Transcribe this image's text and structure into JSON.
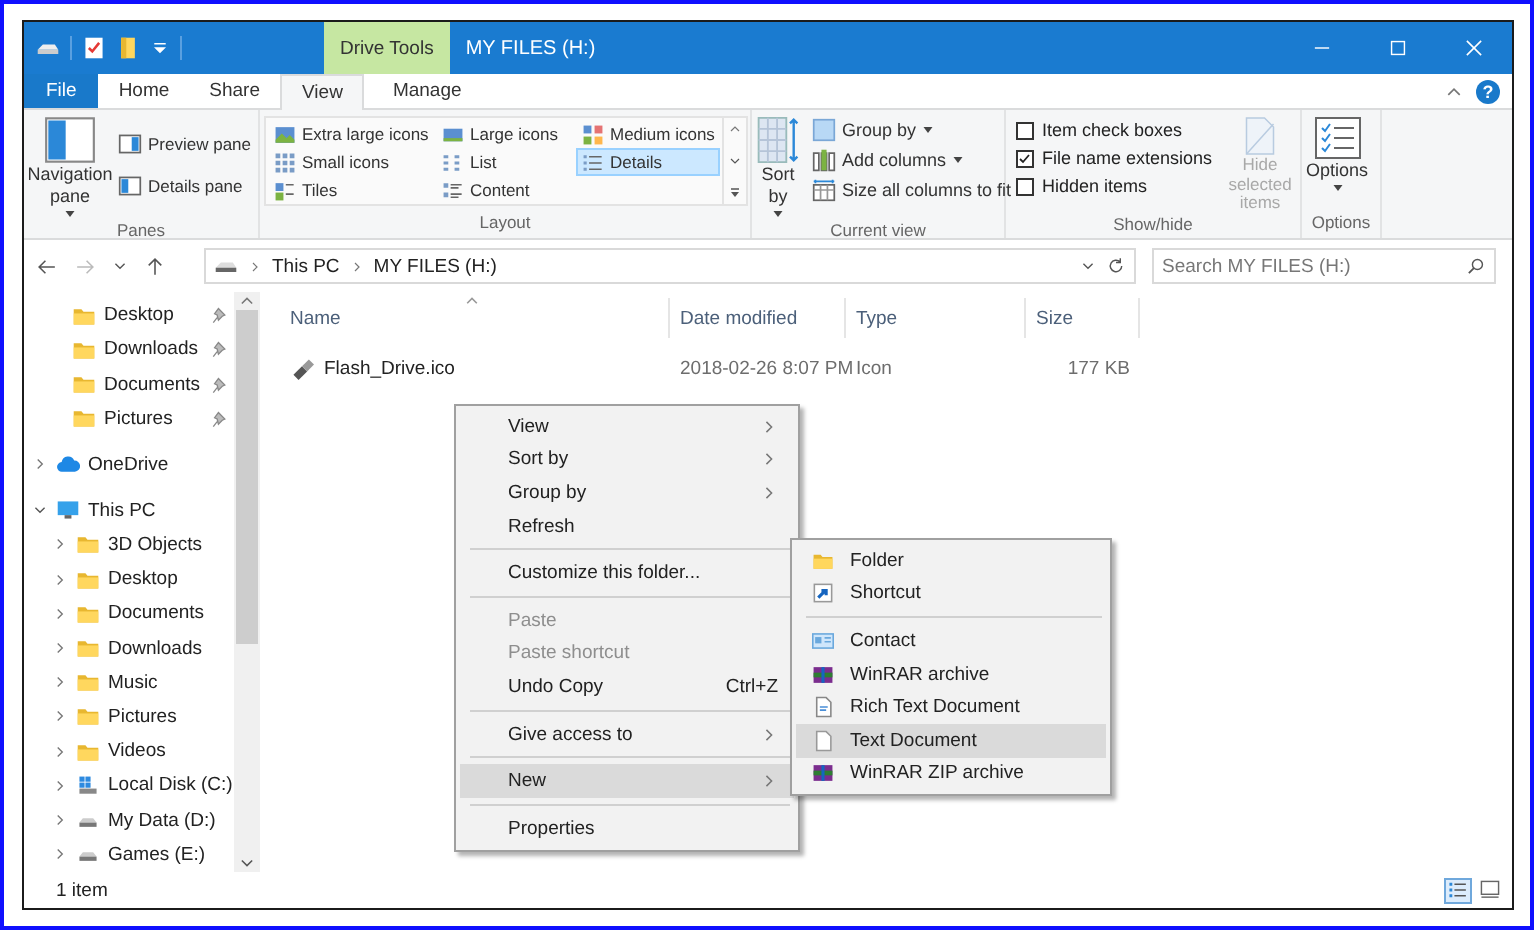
{
  "window": {
    "title": "MY FILES (H:)",
    "context_tab": "Drive Tools"
  },
  "ribbon_tabs": [
    {
      "label": "File",
      "kind": "file",
      "selected": false
    },
    {
      "label": "Home",
      "kind": "tab",
      "selected": false
    },
    {
      "label": "Share",
      "kind": "tab",
      "selected": false
    },
    {
      "label": "View",
      "kind": "tab",
      "selected": true
    },
    {
      "label": "Manage",
      "kind": "tab",
      "selected": false
    }
  ],
  "help": "?",
  "ribbon": {
    "panes": {
      "label": "Panes",
      "navigation_pane": "Navigation pane",
      "buttons": [
        "Preview pane",
        "Details pane"
      ]
    },
    "layout": {
      "label": "Layout",
      "options": [
        {
          "label": "Extra large icons",
          "selected": false
        },
        {
          "label": "Large icons",
          "selected": false
        },
        {
          "label": "Medium icons",
          "selected": false
        },
        {
          "label": "Small icons",
          "selected": false
        },
        {
          "label": "List",
          "selected": false
        },
        {
          "label": "Details",
          "selected": true
        },
        {
          "label": "Tiles",
          "selected": false
        },
        {
          "label": "Content",
          "selected": false
        }
      ]
    },
    "current_view": {
      "label": "Current view",
      "sort": "Sort by",
      "buttons": [
        "Group by",
        "Add columns",
        "Size all columns to fit"
      ]
    },
    "show_hide": {
      "label": "Show/hide",
      "checkboxes": [
        {
          "label": "Item check boxes",
          "checked": false
        },
        {
          "label": "File name extensions",
          "checked": true
        },
        {
          "label": "Hidden items",
          "checked": false
        }
      ],
      "hide_selected": {
        "label": "Hide selected items",
        "disabled": true
      }
    },
    "options": {
      "label": "Options",
      "button_label": "Options"
    }
  },
  "address_bar": {
    "path": [
      "This PC",
      "MY FILES (H:)"
    ],
    "search": {
      "placeholder": "Search MY FILES (H:)"
    }
  },
  "navigation_pane": {
    "quick_access": [
      {
        "label": "Desktop",
        "pinned": true
      },
      {
        "label": "Downloads",
        "pinned": true
      },
      {
        "label": "Documents",
        "pinned": true
      },
      {
        "label": "Pictures",
        "pinned": true
      }
    ],
    "tree": [
      {
        "label": "OneDrive",
        "kind": "cloud",
        "expanded": false
      },
      {
        "label": "This PC",
        "kind": "pc",
        "expanded": true,
        "children": [
          {
            "label": "3D Objects",
            "kind": "folder",
            "expanded": false
          },
          {
            "label": "Desktop",
            "kind": "folder",
            "expanded": false
          },
          {
            "label": "Documents",
            "kind": "folder",
            "expanded": false
          },
          {
            "label": "Downloads",
            "kind": "folder",
            "expanded": false
          },
          {
            "label": "Music",
            "kind": "folder",
            "expanded": false
          },
          {
            "label": "Pictures",
            "kind": "folder",
            "expanded": false
          },
          {
            "label": "Videos",
            "kind": "folder",
            "expanded": false
          },
          {
            "label": "Local Disk (C:)",
            "kind": "system_drive",
            "expanded": false
          },
          {
            "label": "My Data (D:)",
            "kind": "drive",
            "expanded": false
          },
          {
            "label": "Games (E:)",
            "kind": "drive",
            "expanded": false
          }
        ]
      }
    ]
  },
  "file_list": {
    "columns": [
      "Name",
      "Date modified",
      "Type",
      "Size"
    ],
    "rows": [
      {
        "name": "Flash_Drive.ico",
        "date_modified": "2018-02-26 8:07 PM",
        "type": "Icon",
        "size": "177 KB"
      }
    ]
  },
  "context_menu": {
    "groups": [
      {
        "items": [
          {
            "label": "View",
            "submenu": true,
            "disabled": false,
            "selected": false
          },
          {
            "label": "Sort by",
            "submenu": true,
            "disabled": false,
            "selected": false
          },
          {
            "label": "Group by",
            "submenu": true,
            "disabled": false,
            "selected": false
          },
          {
            "label": "Refresh",
            "submenu": false,
            "disabled": false,
            "selected": false
          }
        ]
      },
      {
        "items": [
          {
            "label": "Customize this folder...",
            "submenu": false,
            "disabled": false,
            "selected": false
          }
        ]
      },
      {
        "items": [
          {
            "label": "Paste",
            "submenu": false,
            "disabled": true,
            "selected": false
          },
          {
            "label": "Paste shortcut",
            "submenu": false,
            "disabled": true,
            "selected": false
          },
          {
            "label": "Undo Copy",
            "shortcut": "Ctrl+Z",
            "submenu": false,
            "disabled": false,
            "selected": false
          }
        ]
      },
      {
        "items": [
          {
            "label": "Give access to",
            "submenu": true,
            "disabled": false,
            "selected": false
          }
        ]
      },
      {
        "items": [
          {
            "label": "New",
            "submenu": true,
            "disabled": false,
            "selected": true
          }
        ]
      },
      {
        "items": [
          {
            "label": "Properties",
            "submenu": false,
            "disabled": false,
            "selected": false
          }
        ]
      }
    ]
  },
  "new_submenu": {
    "groups": [
      {
        "items": [
          {
            "label": "Folder",
            "kind": "folder",
            "selected": false
          },
          {
            "label": "Shortcut",
            "kind": "shortcut",
            "selected": false
          }
        ]
      },
      {
        "items": [
          {
            "label": "Contact",
            "kind": "contact",
            "selected": false
          },
          {
            "label": "WinRAR archive",
            "kind": "archive",
            "selected": false
          },
          {
            "label": "Rich Text Document",
            "kind": "rich_text",
            "selected": false
          },
          {
            "label": "Text Document",
            "kind": "text",
            "selected": true
          },
          {
            "label": "WinRAR ZIP archive",
            "kind": "archive",
            "selected": false
          }
        ]
      }
    ]
  },
  "status_bar": {
    "item_count": "1 item",
    "view_buttons": [
      {
        "kind": "details",
        "selected": true
      },
      {
        "kind": "large_icons",
        "selected": false
      }
    ]
  }
}
